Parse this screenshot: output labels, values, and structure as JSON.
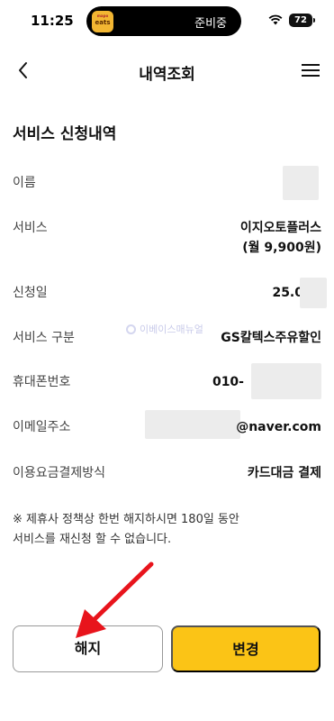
{
  "status_bar": {
    "time": "11:25",
    "app_badge_top": "mapo",
    "app_badge_bottom": "eats",
    "island_text": "준비중",
    "battery": "72"
  },
  "header": {
    "title": "내역조회",
    "back_icon": "chevron-left-icon",
    "menu_icon": "hamburger-menu-icon"
  },
  "section": {
    "title": "서비스 신청내역"
  },
  "rows": [
    {
      "label": "이름",
      "value": ""
    },
    {
      "label": "서비스",
      "value_line1": "이지오토플러스",
      "value_line2": "(월 9,900원)"
    },
    {
      "label": "신청일",
      "value": "25.0"
    },
    {
      "label": "서비스 구분",
      "value": "GS칼텍스주유할인"
    },
    {
      "label": "휴대폰번호",
      "value": "010-"
    },
    {
      "label": "이메일주소",
      "value": "@naver.com"
    },
    {
      "label": "이용요금결제방식",
      "value": "카드대금 결제"
    }
  ],
  "watermark": "이베이스매뉴얼",
  "notice": {
    "line1": "※ 제휴사 정책상 한번 해지하시면 180일 동안",
    "line2": "서비스를 재신청 할 수 없습니다."
  },
  "buttons": {
    "cancel": "해지",
    "change": "변경"
  },
  "colors": {
    "accent_yellow": "#fbc416",
    "arrow_red": "#e8141c"
  }
}
